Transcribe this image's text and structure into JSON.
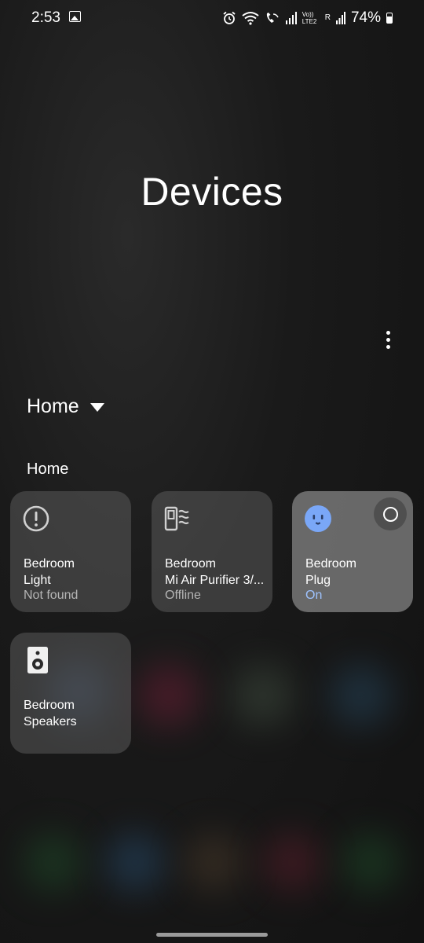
{
  "status_bar": {
    "time": "2:53",
    "icons": [
      "gallery-icon",
      "alarm-icon",
      "wifi-icon",
      "wifi-calling-icon",
      "signal-icon",
      "volte-icon",
      "signal-roaming-icon",
      "battery-icon"
    ],
    "volte_label": "Vo)) LTE2",
    "roaming_label": "R",
    "battery": "74%"
  },
  "header": {
    "title": "Devices"
  },
  "location": {
    "selected": "Home"
  },
  "section": {
    "label": "Home"
  },
  "devices": [
    {
      "line1": "Bedroom",
      "line2": "Light",
      "status": "Not found",
      "icon": "alert-circle-icon"
    },
    {
      "line1": "Bedroom",
      "line2": "Mi Air Purifier 3/...",
      "status": "Offline",
      "icon": "air-purifier-icon"
    },
    {
      "line1": "Bedroom",
      "line2": "Plug",
      "status": "On",
      "icon": "smart-plug-icon"
    },
    {
      "line1": "Bedroom",
      "line2": "Speakers",
      "status": "",
      "icon": "speaker-icon"
    }
  ],
  "colors": {
    "accent_on": "#9ec3ff",
    "plug_icon": "#7aa7f7",
    "card_bg": "#4a4a4a"
  }
}
